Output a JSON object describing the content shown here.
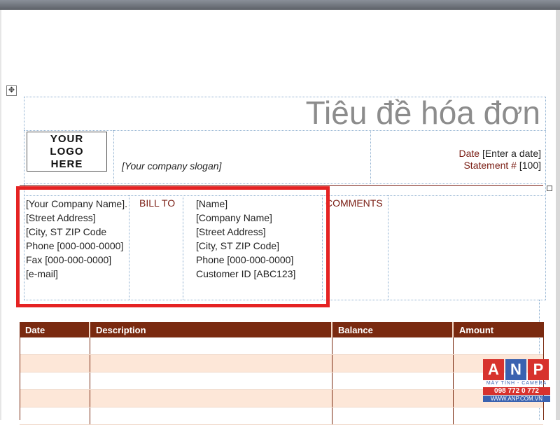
{
  "invoice": {
    "title": "Tiêu đề hóa đơn",
    "logo_text": "YOUR LOGO HERE",
    "slogan": "[Your company slogan]",
    "date_label": "Date",
    "date_value": "[Enter a date]",
    "statement_label": "Statement #",
    "statement_value": "[100]"
  },
  "company": {
    "name": "[Your Company Name].",
    "street": "[Street Address]",
    "city": "[City, ST  ZIP Code",
    "phone": "Phone [000-000-0000]",
    "fax": "Fax [000-000-0000]",
    "email": "[e-mail]"
  },
  "bill_to": {
    "label": "BILL TO",
    "name": "[Name]",
    "company": "[Company Name]",
    "street": "[Street Address]",
    "city": "[City, ST  ZIP Code]",
    "phone": "Phone [000-000-0000]",
    "customer_id": "Customer ID [ABC123]"
  },
  "comments": {
    "label": "COMMENTS"
  },
  "table": {
    "headers": [
      "Date",
      "Description",
      "Balance",
      "Amount"
    ]
  },
  "watermark": {
    "letters": [
      "A",
      "N",
      "P"
    ],
    "tagline": "MÁY TÍNH - CAMERA",
    "phone": "098 772 0 772",
    "url": "WWW.ANP.COM.VN"
  },
  "colors": {
    "accent": "#7a1d13",
    "highlight": "#e52323",
    "row_shade": "#fde7d8"
  }
}
